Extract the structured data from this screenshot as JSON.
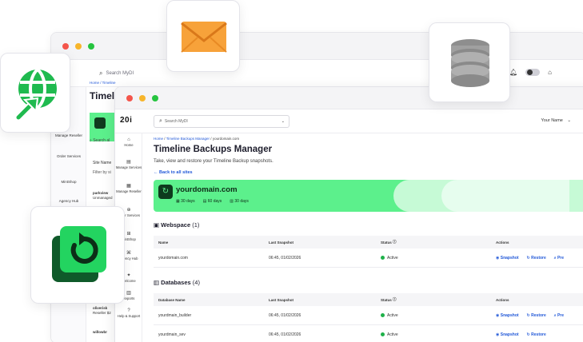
{
  "back_window": {
    "search_placeholder": "Search MyDI",
    "crumb": "Home / Timeline",
    "title": "Timeline",
    "search_label": "Search al",
    "site_name_header": "Site Name",
    "filter_label": "Filter by si",
    "rows": [
      {
        "name": "parkview",
        "sub": "Unmanaged"
      },
      {
        "name": "oliverisk",
        "sub": "Reseller $2"
      },
      {
        "name": "willowbr",
        "sub": ""
      }
    ],
    "side_items": [
      "Manage Reseller",
      "Order Services",
      "MintShop",
      "Agency Hub"
    ]
  },
  "front_window": {
    "logo": "20i",
    "search_placeholder": "Search MyDI",
    "user_name": "Your Name",
    "side_items": [
      {
        "label": "Home",
        "icon": "⌂"
      },
      {
        "label": "Manage Services",
        "icon": "▤"
      },
      {
        "label": "Manage Reseller",
        "icon": "▦"
      },
      {
        "label": "Order Services",
        "icon": "⊕"
      },
      {
        "label": "MintShop",
        "icon": "⊞"
      },
      {
        "label": "Agency Hub",
        "icon": "⌘"
      },
      {
        "label": "Welcome",
        "icon": "✦"
      },
      {
        "label": "Reports",
        "icon": "▥"
      },
      {
        "label": "Help & Support",
        "icon": "?"
      }
    ],
    "crumb": {
      "home": "Home",
      "section": "Timeline Backups Manager",
      "current": "yourdomain.com"
    },
    "title": "Timeline Backups Manager",
    "subtitle": "Take, view and restore your Timeline Backup snapshots.",
    "back_link": "← Back to all sites",
    "domain_card": {
      "domain": "yourdomain.com",
      "stats": [
        "30 days",
        "60 days",
        "30 days"
      ]
    },
    "webspace": {
      "title": "Webspace",
      "count": "(1)",
      "headers": [
        "Name",
        "Last Snapshot",
        "Status",
        "Actions"
      ],
      "rows": [
        {
          "name": "yourdomain.com",
          "snapshot": "06:45, 01/02/2026",
          "status": "Active"
        }
      ]
    },
    "databases": {
      "title": "Databases",
      "count": "(4)",
      "headers": [
        "Database Name",
        "Last Snapshot",
        "Status",
        "Actions"
      ],
      "rows": [
        {
          "name": "yourdmain_builder",
          "snapshot": "06:45, 01/02/2026",
          "status": "Active"
        },
        {
          "name": "yourdmain_sev",
          "snapshot": "06:45, 01/02/2026",
          "status": "Active"
        }
      ]
    },
    "actions": {
      "snapshot": "Snapshot",
      "restore": "Restore",
      "preview": "Pre"
    }
  },
  "colors": {
    "brand_green": "#5cf08c",
    "dark_green": "#0e3b1e",
    "link_blue": "#2158d8",
    "envelope_orange": "#f7a23a",
    "database_gray": "#9a9a9a"
  },
  "icons": {
    "globe_tile": "globe-arrow-icon",
    "envelope_tile": "envelope-icon",
    "database_tile": "database-icon",
    "restore_tile": "restore-icon"
  }
}
